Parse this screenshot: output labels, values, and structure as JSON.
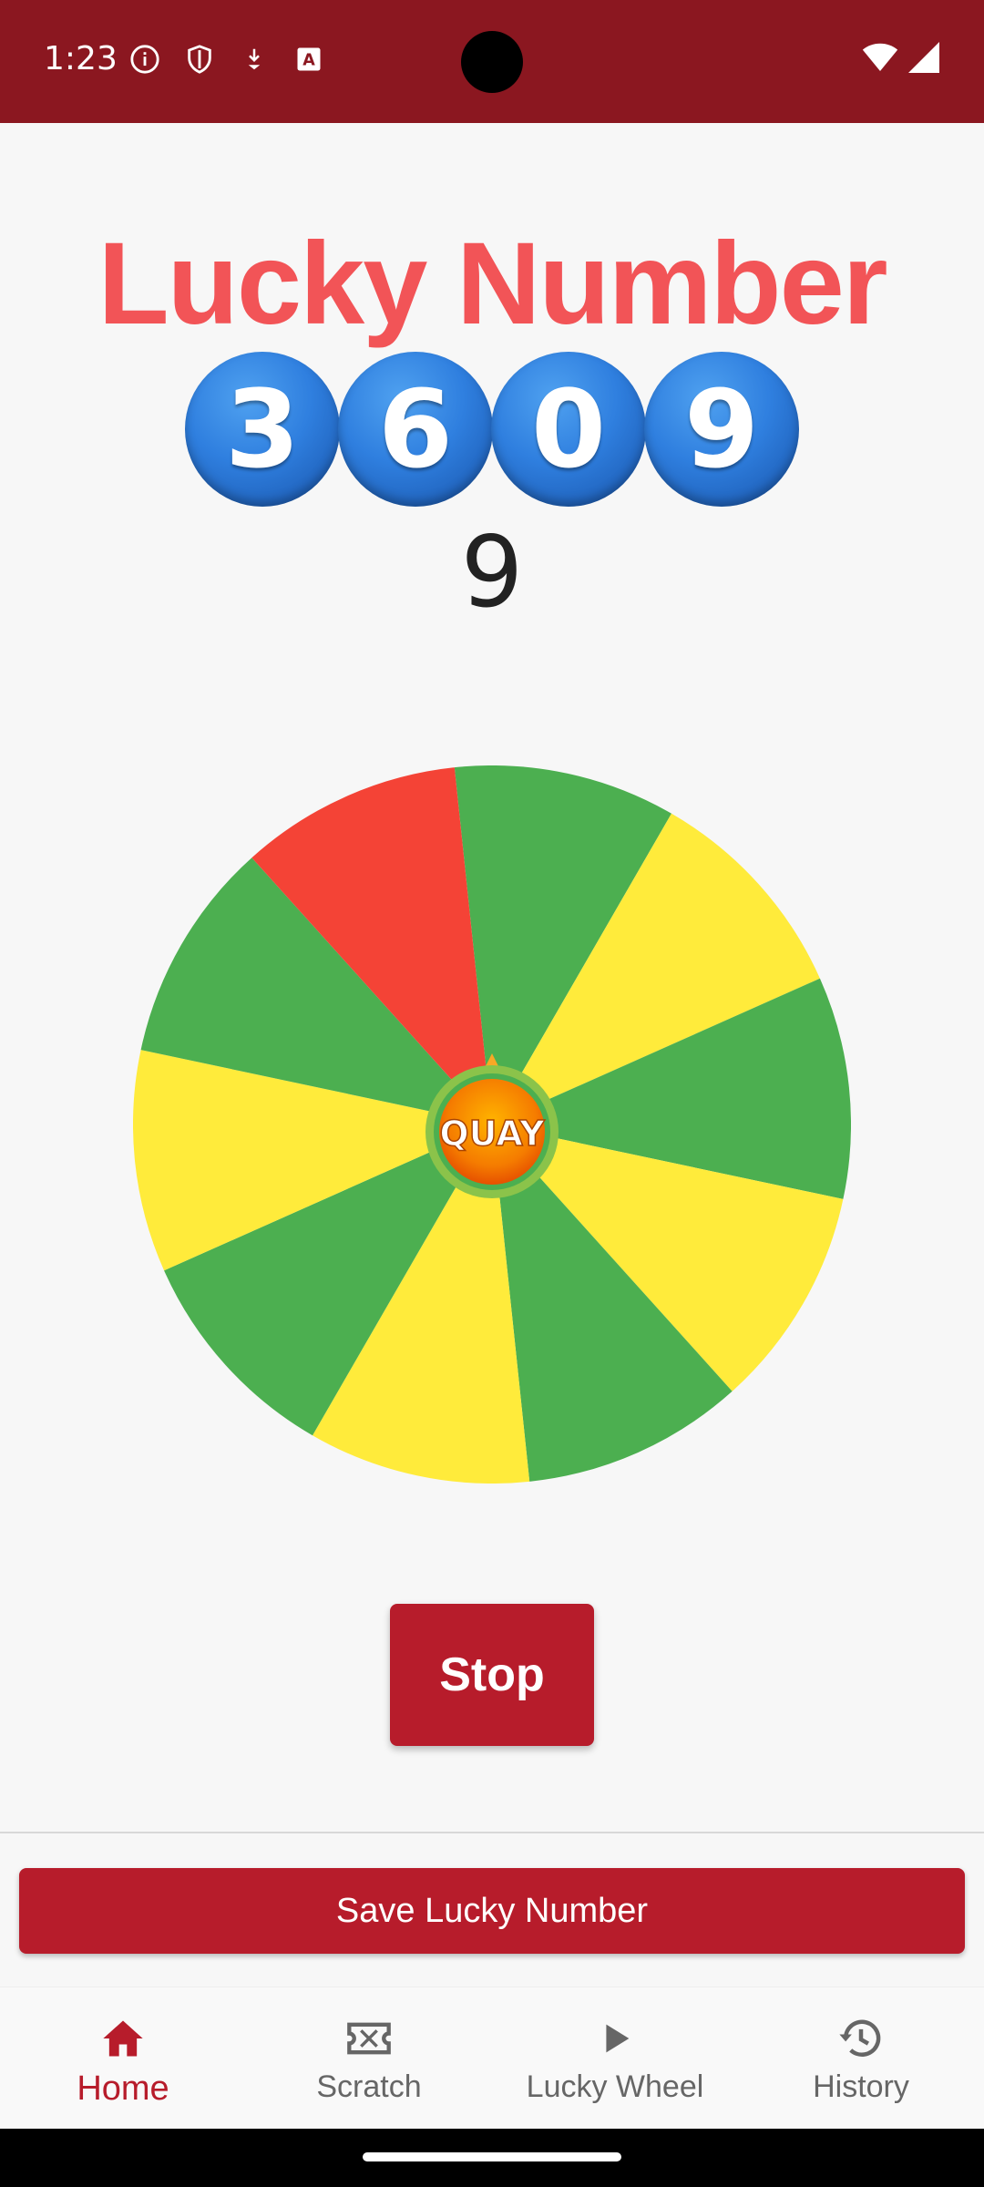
{
  "status_bar": {
    "time": "1:23",
    "left_icons": [
      "info-icon",
      "shield-icon",
      "download-icon",
      "text-icon"
    ],
    "right_icons": [
      "wifi-icon",
      "signal-icon"
    ],
    "color": "#8b1720"
  },
  "header": {
    "title": "Lucky Number",
    "title_color": "#f25457"
  },
  "lucky_digits": [
    "3",
    "6",
    "0",
    "9"
  ],
  "result": "9",
  "wheel": {
    "center_label": "QUAY",
    "segment_colors": [
      "#4caf50",
      "#ffeb3b",
      "#4caf50",
      "#ffeb3b",
      "#4caf50",
      "#ffeb3b",
      "#4caf50",
      "#ffeb3b",
      "#4caf50",
      "#f44336"
    ]
  },
  "actions": {
    "stop_label": "Stop",
    "save_label": "Save Lucky Number",
    "accent": "#b71c2b"
  },
  "bottom_nav": {
    "items": [
      {
        "label": "Home",
        "icon": "home-icon",
        "active": true
      },
      {
        "label": "Scratch",
        "icon": "ticket-icon",
        "active": false
      },
      {
        "label": "Lucky Wheel",
        "icon": "play-icon",
        "active": false
      },
      {
        "label": "History",
        "icon": "history-icon",
        "active": false
      }
    ]
  }
}
